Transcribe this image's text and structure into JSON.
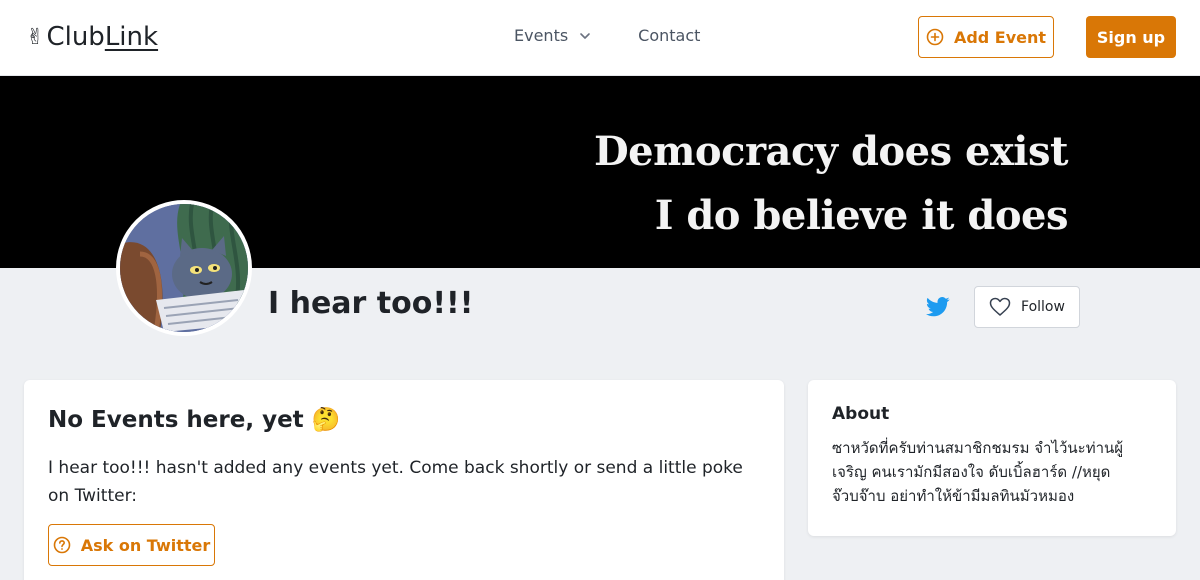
{
  "header": {
    "logo_hand": "✌",
    "logo_club": "Club",
    "logo_link": "Link",
    "nav": {
      "events_label": "Events",
      "contact_label": "Contact"
    },
    "add_event_label": "Add Event",
    "signup_label": "Sign up"
  },
  "banner": {
    "line1": "Democracy does exist",
    "line2": "I do believe it does"
  },
  "profile": {
    "name": "I hear too!!!",
    "follow_label": "Follow"
  },
  "events": {
    "title": "No Events here, yet 🤔",
    "message": "I hear too!!! hasn't added any events yet. Come back shortly or send a little poke on Twitter:",
    "ask_label": "Ask on Twitter"
  },
  "about": {
    "title": "About",
    "text": "ซาหวัดที่ครับท่านสมาชิกชมรม จำไว้นะท่านผู้เจริญ คนเรามักมีสองใจ ดับเบิ้ลฮาร์ด //หยุดจ๊วบจ๊าบ อย่าทำให้ข้ามีมลทินมัวหมอง"
  },
  "colors": {
    "accent": "#d97706",
    "twitter": "#1d9bf0",
    "page_bg": "#eef0f3"
  },
  "icons": {
    "add_event": "plus-circle-icon",
    "events_menu": "chevron-down-icon",
    "twitter": "twitter-icon",
    "follow": "heart-icon",
    "ask": "question-circle-icon"
  }
}
